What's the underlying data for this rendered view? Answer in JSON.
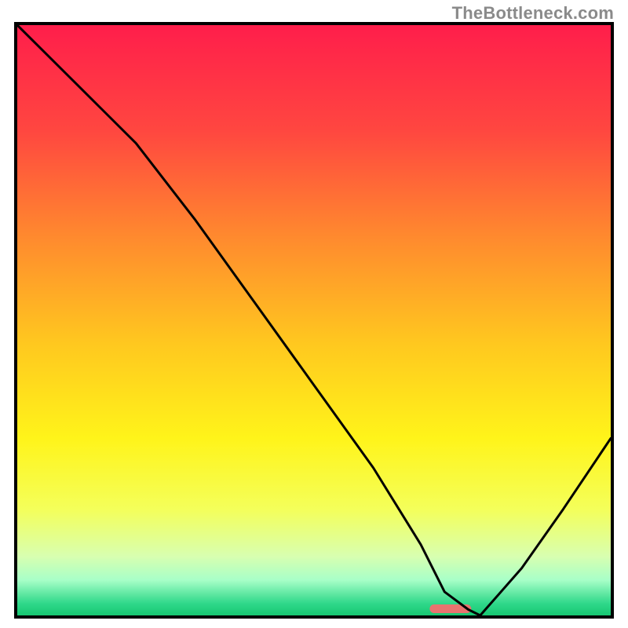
{
  "watermark": "TheBottleneck.com",
  "chart_data": {
    "type": "line",
    "title": "",
    "xlabel": "",
    "ylabel": "",
    "xlim": [
      0,
      100
    ],
    "ylim": [
      0,
      100
    ],
    "grid": false,
    "legend": false,
    "annotations": [],
    "series": [
      {
        "name": "bottleneck-curve",
        "x": [
          0,
          10,
          20,
          30,
          40,
          50,
          60,
          68,
          72,
          76,
          78,
          85,
          92,
          100
        ],
        "y": [
          100,
          90,
          80,
          67,
          53,
          39,
          25,
          12,
          4,
          1,
          0,
          8,
          18,
          30
        ]
      }
    ],
    "background_gradient": {
      "stops": [
        {
          "pos": 0.0,
          "color": "#ff1e4b"
        },
        {
          "pos": 0.18,
          "color": "#ff4740"
        },
        {
          "pos": 0.36,
          "color": "#ff8a2e"
        },
        {
          "pos": 0.54,
          "color": "#ffc81f"
        },
        {
          "pos": 0.7,
          "color": "#fff41a"
        },
        {
          "pos": 0.82,
          "color": "#f4ff5a"
        },
        {
          "pos": 0.9,
          "color": "#d8ffb0"
        },
        {
          "pos": 0.94,
          "color": "#a8ffc8"
        },
        {
          "pos": 0.965,
          "color": "#5be6a0"
        },
        {
          "pos": 0.98,
          "color": "#2fd88a"
        },
        {
          "pos": 1.0,
          "color": "#17c772"
        }
      ]
    },
    "marker": {
      "x_center_pct": 73,
      "width_pct": 7,
      "color": "#e9736f"
    }
  }
}
